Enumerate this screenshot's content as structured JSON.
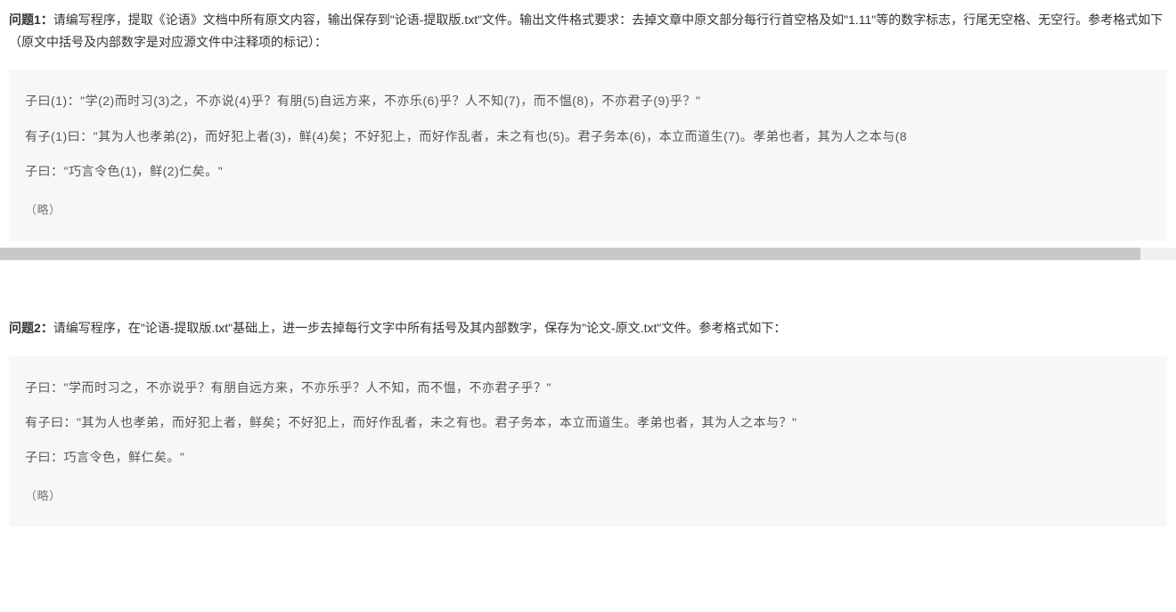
{
  "problem1": {
    "label": "问题1：",
    "text": "请编写程序，提取《论语》文档中所有原文内容，输出保存到\"论语-提取版.txt\"文件。输出文件格式要求：去掉文章中原文部分每行行首空格及如\"1.11\"等的数字标志，行尾无空格、无空行。参考格式如下（原文中括号及内部数字是对应源文件中注释项的标记）：",
    "code_lines": [
      "子曰(1)：\"学(2)而时习(3)之，不亦说(4)乎？有朋(5)自远方来，不亦乐(6)乎？人不知(7)，而不愠(8)，不亦君子(9)乎？\"",
      "有子(1)曰：\"其为人也孝弟(2)，而好犯上者(3)，鲜(4)矣；不好犯上，而好作乱者，未之有也(5)。君子务本(6)，本立而道生(7)。孝弟也者，其为人之本与(8",
      "子曰：\"巧言令色(1)，鲜(2)仁矣。\""
    ],
    "omit": "（略）"
  },
  "problem2": {
    "label": "问题2：",
    "text": "请编写程序，在\"论语-提取版.txt\"基础上，进一步去掉每行文字中所有括号及其内部数字，保存为\"论文-原文.txt\"文件。参考格式如下：",
    "code_lines": [
      "子曰：\"学而时习之，不亦说乎？有朋自远方来，不亦乐乎？人不知，而不愠，不亦君子乎？\"",
      "有子曰：\"其为人也孝弟，而好犯上者，鲜矣；不好犯上，而好作乱者，未之有也。君子务本，本立而道生。孝弟也者，其为人之本与？\"",
      "子曰：巧言令色，鲜仁矣。\""
    ],
    "omit": "（略）"
  }
}
